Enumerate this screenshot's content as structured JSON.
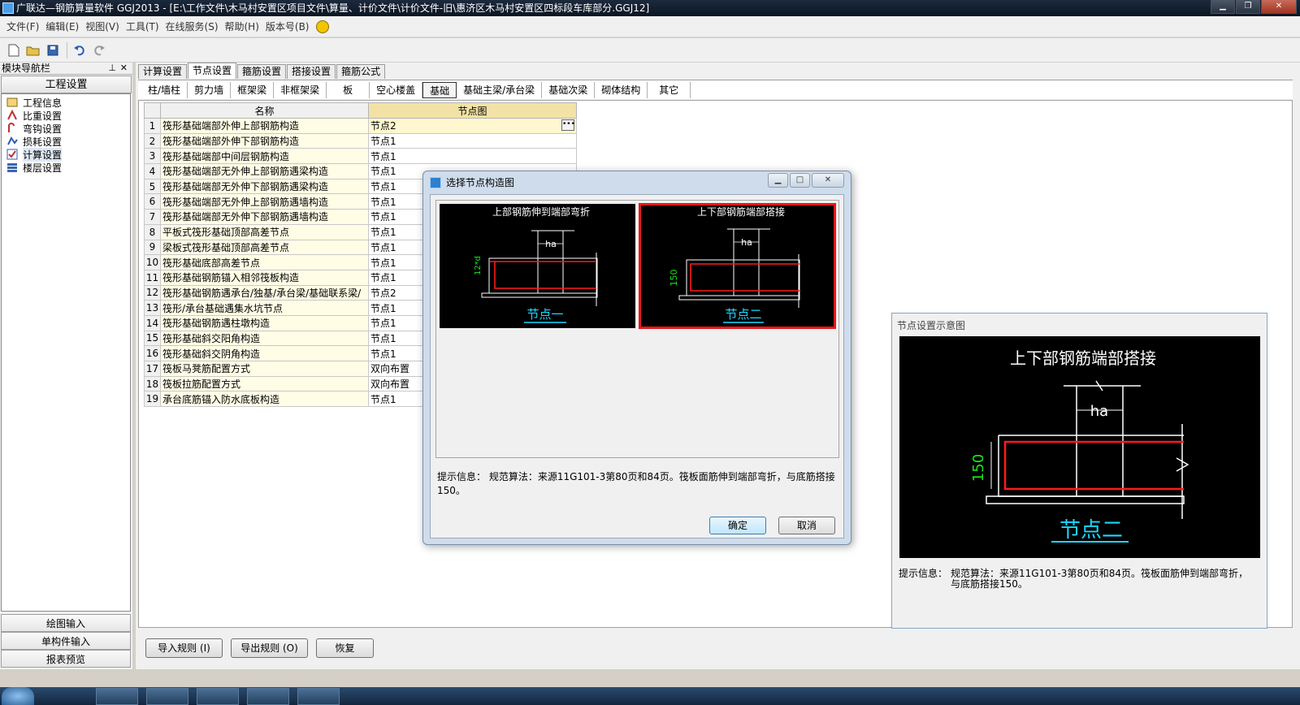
{
  "window": {
    "title": "广联达—钢筋算量软件 GGJ2013 - [E:\\工作文件\\木马村安置区项目文件\\算量、计价文件\\计价文件-旧\\惠济区木马村安置区四标段车库部分.GGJ12]"
  },
  "menubar": {
    "items": [
      "文件(F)",
      "编辑(E)",
      "视图(V)",
      "工具(T)",
      "在线服务(S)",
      "帮助(H)",
      "版本号(B)"
    ]
  },
  "nav": {
    "header": "模块导航栏",
    "section": "工程设置",
    "tree": [
      "工程信息",
      "比重设置",
      "弯钩设置",
      "损耗设置",
      "计算设置",
      "楼层设置"
    ],
    "bottom": [
      "绘图输入",
      "单构件输入",
      "报表预览"
    ]
  },
  "tabs": [
    "计算设置",
    "节点设置",
    "箍筋设置",
    "搭接设置",
    "箍筋公式"
  ],
  "subtabs": [
    "柱/墙柱",
    "剪力墙",
    "框架梁",
    "非框架梁",
    "板",
    "空心楼盖",
    "基础",
    "基础主梁/承台梁",
    "基础次梁",
    "砌体结构",
    "其它"
  ],
  "grid": {
    "header_name": "名称",
    "header_node": "节点图",
    "rows": [
      {
        "no": "1",
        "name": "筏形基础端部外伸上部钢筋构造",
        "node": "节点2"
      },
      {
        "no": "2",
        "name": "筏形基础端部外伸下部钢筋构造",
        "node": "节点1"
      },
      {
        "no": "3",
        "name": "筏形基础端部中间层钢筋构造",
        "node": "节点1"
      },
      {
        "no": "4",
        "name": "筏形基础端部无外伸上部钢筋遇梁构造",
        "node": "节点1"
      },
      {
        "no": "5",
        "name": "筏形基础端部无外伸下部钢筋遇梁构造",
        "node": "节点1"
      },
      {
        "no": "6",
        "name": "筏形基础端部无外伸上部钢筋遇墙构造",
        "node": "节点1"
      },
      {
        "no": "7",
        "name": "筏形基础端部无外伸下部钢筋遇墙构造",
        "node": "节点1"
      },
      {
        "no": "8",
        "name": "平板式筏形基础顶部高差节点",
        "node": "节点1"
      },
      {
        "no": "9",
        "name": "梁板式筏形基础顶部高差节点",
        "node": "节点1"
      },
      {
        "no": "10",
        "name": "筏形基础底部高差节点",
        "node": "节点1"
      },
      {
        "no": "11",
        "name": "筏形基础钢筋锚入相邻筏板构造",
        "node": "节点1"
      },
      {
        "no": "12",
        "name": "筏形基础钢筋遇承台/独基/承台梁/基础联系梁/",
        "node": "节点2"
      },
      {
        "no": "13",
        "name": "筏形/承台基础遇集水坑节点",
        "node": "节点1"
      },
      {
        "no": "14",
        "name": "筏形基础钢筋遇柱墩构造",
        "node": "节点1"
      },
      {
        "no": "15",
        "name": "筏形基础斜交阳角构造",
        "node": "节点1"
      },
      {
        "no": "16",
        "name": "筏形基础斜交阴角构造",
        "node": "节点1"
      },
      {
        "no": "17",
        "name": "筏板马凳筋配置方式",
        "node": "双向布置"
      },
      {
        "no": "18",
        "name": "筏板拉筋配置方式",
        "node": "双向布置"
      },
      {
        "no": "19",
        "name": "承台底筋锚入防水底板构造",
        "node": "节点1"
      }
    ]
  },
  "bottom_buttons": [
    "导入规则 (I)",
    "导出规则 (O)",
    "恢复"
  ],
  "dialog": {
    "title": "选择节点构造图",
    "thumb1": {
      "title": "上部钢筋伸到端部弯折",
      "dim": "12*d",
      "ha": "ha",
      "label": "节点一"
    },
    "thumb2": {
      "title": "上下部钢筋端部搭接",
      "dim": "150",
      "ha": "ha",
      "label": "节点二"
    },
    "hint": "提示信息：  规范算法：来源11G101-3第80页和84页。筏板面筋伸到端部弯折，与底筋搭接150。",
    "ok": "确定",
    "cancel": "取消"
  },
  "preview": {
    "title": "节点设置示意图",
    "img_title": "上下部钢筋端部搭接",
    "dim": "150",
    "ha": "ha",
    "label": "节点二",
    "hint_label": "提示信息：",
    "hint_text": "规范算法：来源11G101-3第80页和84页。筏板面筋伸到端部弯折，与底筋搭接150。"
  },
  "colors": {
    "rebar_red": "#ff1a1a",
    "dim_green": "#19e619",
    "label_cyan": "#1ad8ff",
    "selected_outline": "#e8151b"
  }
}
